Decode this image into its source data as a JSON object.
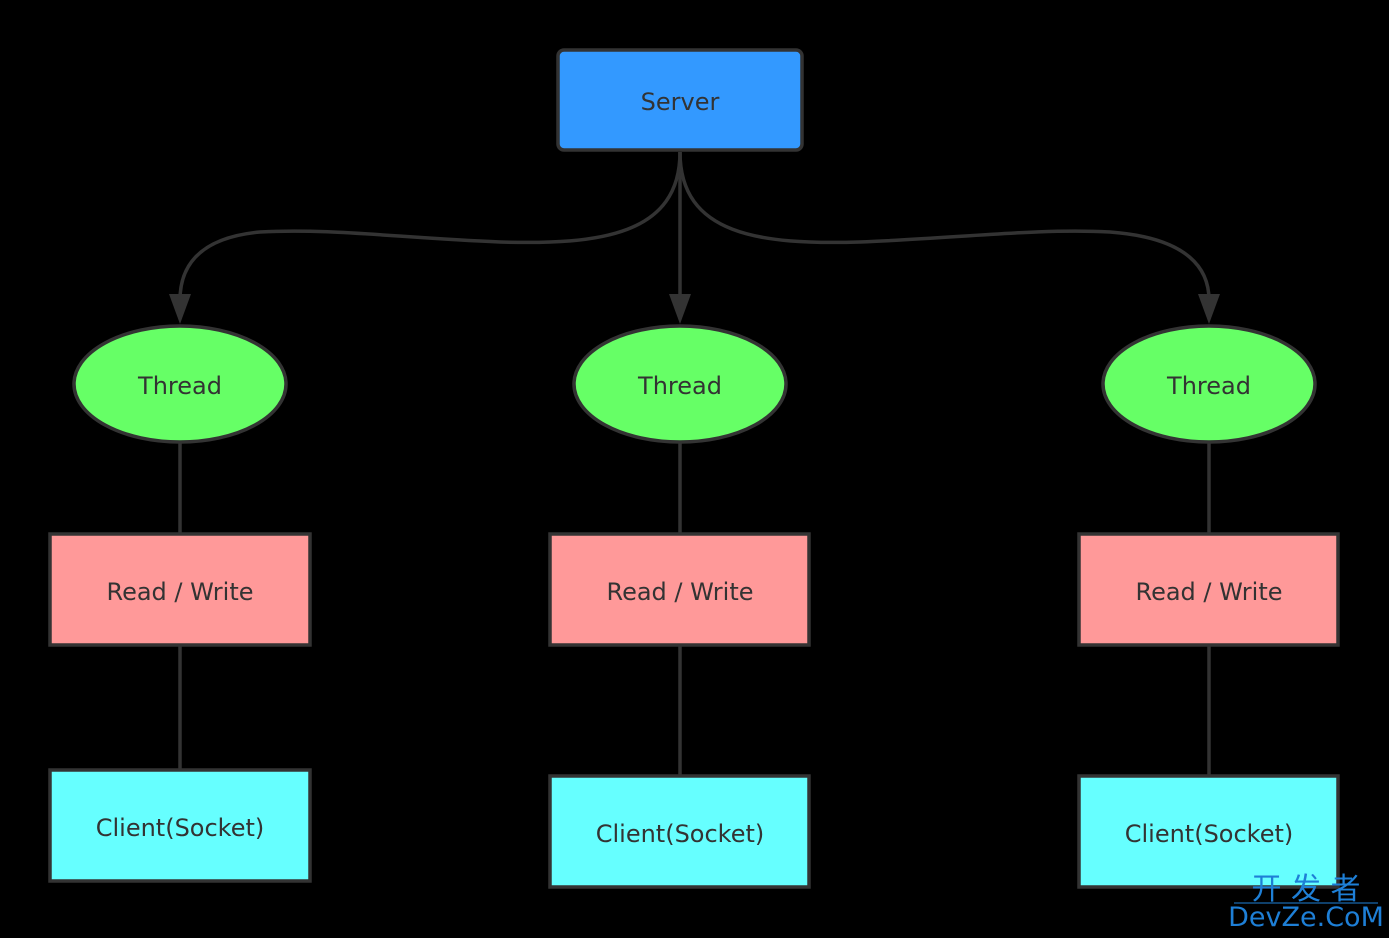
{
  "colors": {
    "server": "#3399ff",
    "thread": "#66ff66",
    "read_write": "#ff9999",
    "client": "#66ffff",
    "stroke": "#333333",
    "background": "#000000"
  },
  "server": {
    "label": "Server"
  },
  "branches": [
    {
      "thread": "Thread",
      "io": "Read / Write",
      "client": "Client(Socket)"
    },
    {
      "thread": "Thread",
      "io": "Read / Write",
      "client": "Client(Socket)"
    },
    {
      "thread": "Thread",
      "io": "Read / Write",
      "client": "Client(Socket)"
    }
  ],
  "watermark": {
    "line1": "开 发 者",
    "line2": "DevZe.CoM"
  }
}
